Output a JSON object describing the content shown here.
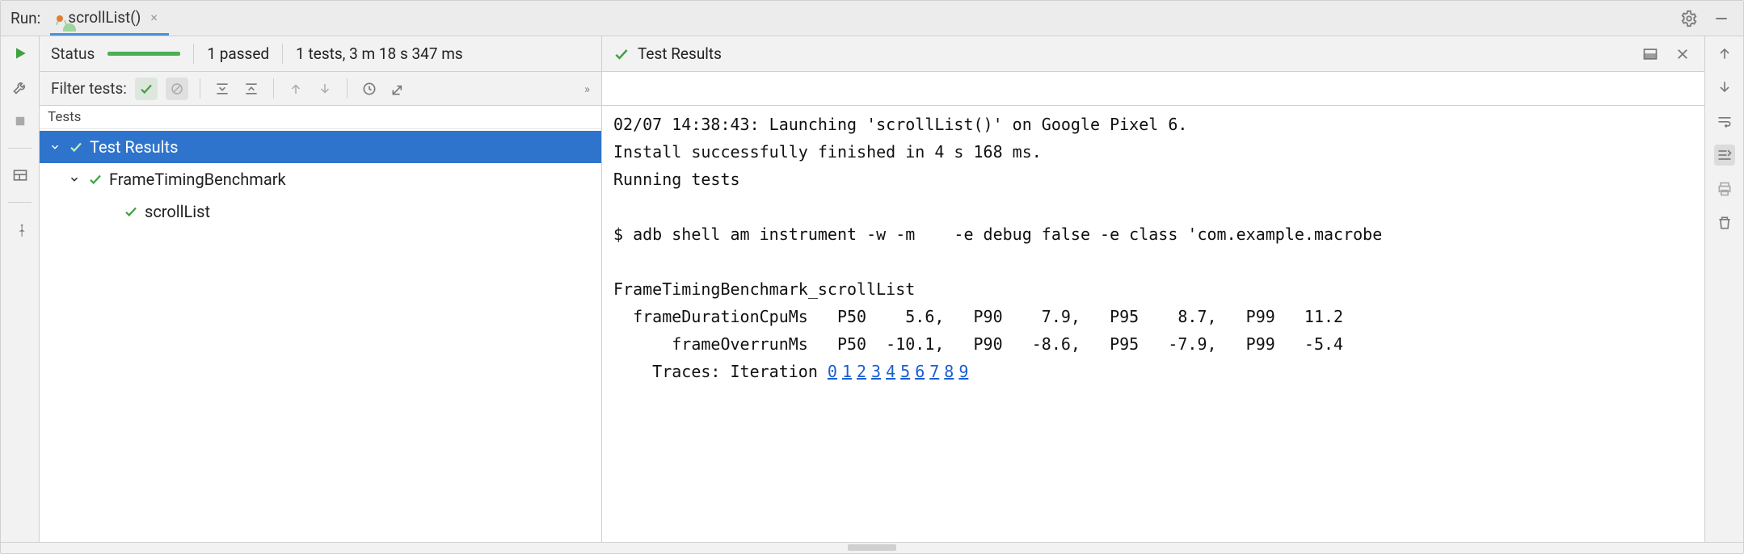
{
  "tabstrip": {
    "run_label": "Run:",
    "tab_title": "scrollList()",
    "gear_icon": "gear",
    "minimize_icon": "minimize"
  },
  "left_tools": {
    "run": "run",
    "wrench": "wrench",
    "stop": "stop",
    "layout": "layout",
    "pin": "pin"
  },
  "status": {
    "label": "Status",
    "passed": "1 passed",
    "totals": "1 tests, 3 m 18 s 347 ms",
    "results_header": "Test Results"
  },
  "filter": {
    "label": "Filter tests:"
  },
  "tree": {
    "header": "Tests",
    "items": [
      {
        "label": "Test Results",
        "depth": 0,
        "selected": true,
        "expandable": true
      },
      {
        "label": "FrameTimingBenchmark",
        "depth": 1,
        "selected": false,
        "expandable": true
      },
      {
        "label": "scrollList",
        "depth": 2,
        "selected": false,
        "expandable": false
      }
    ]
  },
  "console": {
    "line1": "02/07 14:38:43: Launching 'scrollList()' on Google Pixel 6.",
    "line2": "Install successfully finished in 4 s 168 ms.",
    "line3": "Running tests",
    "blank1": "",
    "line4": "$ adb shell am instrument -w -m    -e debug false -e class 'com.example.macrobe",
    "blank2": "",
    "line5": "FrameTimingBenchmark_scrollList",
    "line6": "  frameDurationCpuMs   P50    5.6,   P90    7.9,   P95    8.7,   P99   11.2",
    "line7": "      frameOverrunMs   P50  -10.1,   P90   -8.6,   P95   -7.9,   P99   -5.4",
    "traces_prefix": "    Traces: Iteration ",
    "trace_links": [
      "0",
      "1",
      "2",
      "3",
      "4",
      "5",
      "6",
      "7",
      "8",
      "9"
    ]
  },
  "right_tools": {
    "up": "up",
    "down": "down",
    "wrap": "wrap",
    "scroll_end": "scroll-to-end",
    "print": "print",
    "trash": "trash"
  },
  "status_right_icons": {
    "layout_icon": "layout",
    "close_icon": "close"
  }
}
